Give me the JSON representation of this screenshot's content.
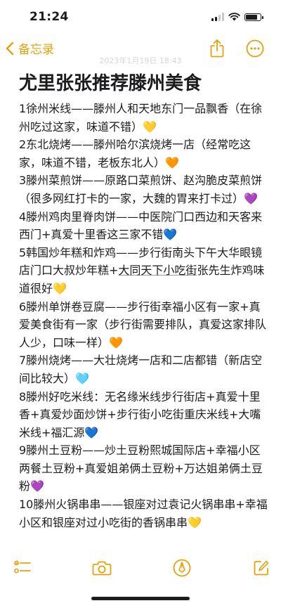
{
  "status_bar": {
    "time": "21:24",
    "battery_level": 0.82
  },
  "nav": {
    "back_label": "备忘录"
  },
  "note": {
    "faded_date": "2023年1月19日 18:43",
    "title": "尤里张张推荐滕州美食",
    "items": [
      {
        "text": "1徐州米线——滕州人和天地东门一品飘香（在徐州吃过这家，味道不错）💛"
      },
      {
        "text": "2东北烧烤——滕州哈尔滨烧烤一店（经常吃这家，味道不错，老板东北人）🧡"
      },
      {
        "text": "3滕州菜煎饼——原路口菜煎饼、赵沟脆皮菜煎饼（很多网红打卡的一家，大魏的胃来打卡过）💜"
      },
      {
        "text": "4滕州鸡肉里脊肉饼——中医院门口西边和天客来西门+真爱十里香这三家不错💙"
      },
      {
        "pre": "5韩国炒年糕和炸鸡——步行街南头下午大华眼镜店门口大叔炒年糕+",
        "link": "大同天下小吃街",
        "post": "张先生炸鸡味道很好💛"
      },
      {
        "text": "6滕州单饼卷豆腐——步行街幸福小区有一家+真爱美食街有一家（步行街需要排队，真爱这家排队人少，口味一样）🧡"
      },
      {
        "text": "7滕州烧烤——大壮烧烤一店和二店都错（新店空间比较大）🩵"
      },
      {
        "text": "8滕州好吃米线：无名缘米线步行街店+真爱十里香+真爱炒面炒饼+步行街小吃街重庆米线+大嘴米线+福汇源💙"
      },
      {
        "text": "9滕州土豆粉——炒土豆粉熙城国际店+幸福小区两餐土豆粉+真爱姐弟俩土豆粉+万达姐弟俩土豆粉💜"
      },
      {
        "text": "10滕州火锅串串——银座对过袁记火锅串串+幸福小区和银座对过小吃街的香锅串串💛"
      }
    ]
  },
  "toolbar": {
    "tools": [
      "checklist-icon",
      "camera-icon",
      "markup-icon",
      "compose-icon"
    ]
  },
  "colors": {
    "accent": "#e3a20d",
    "text": "#1c1c1e",
    "background": "#ffffff"
  }
}
